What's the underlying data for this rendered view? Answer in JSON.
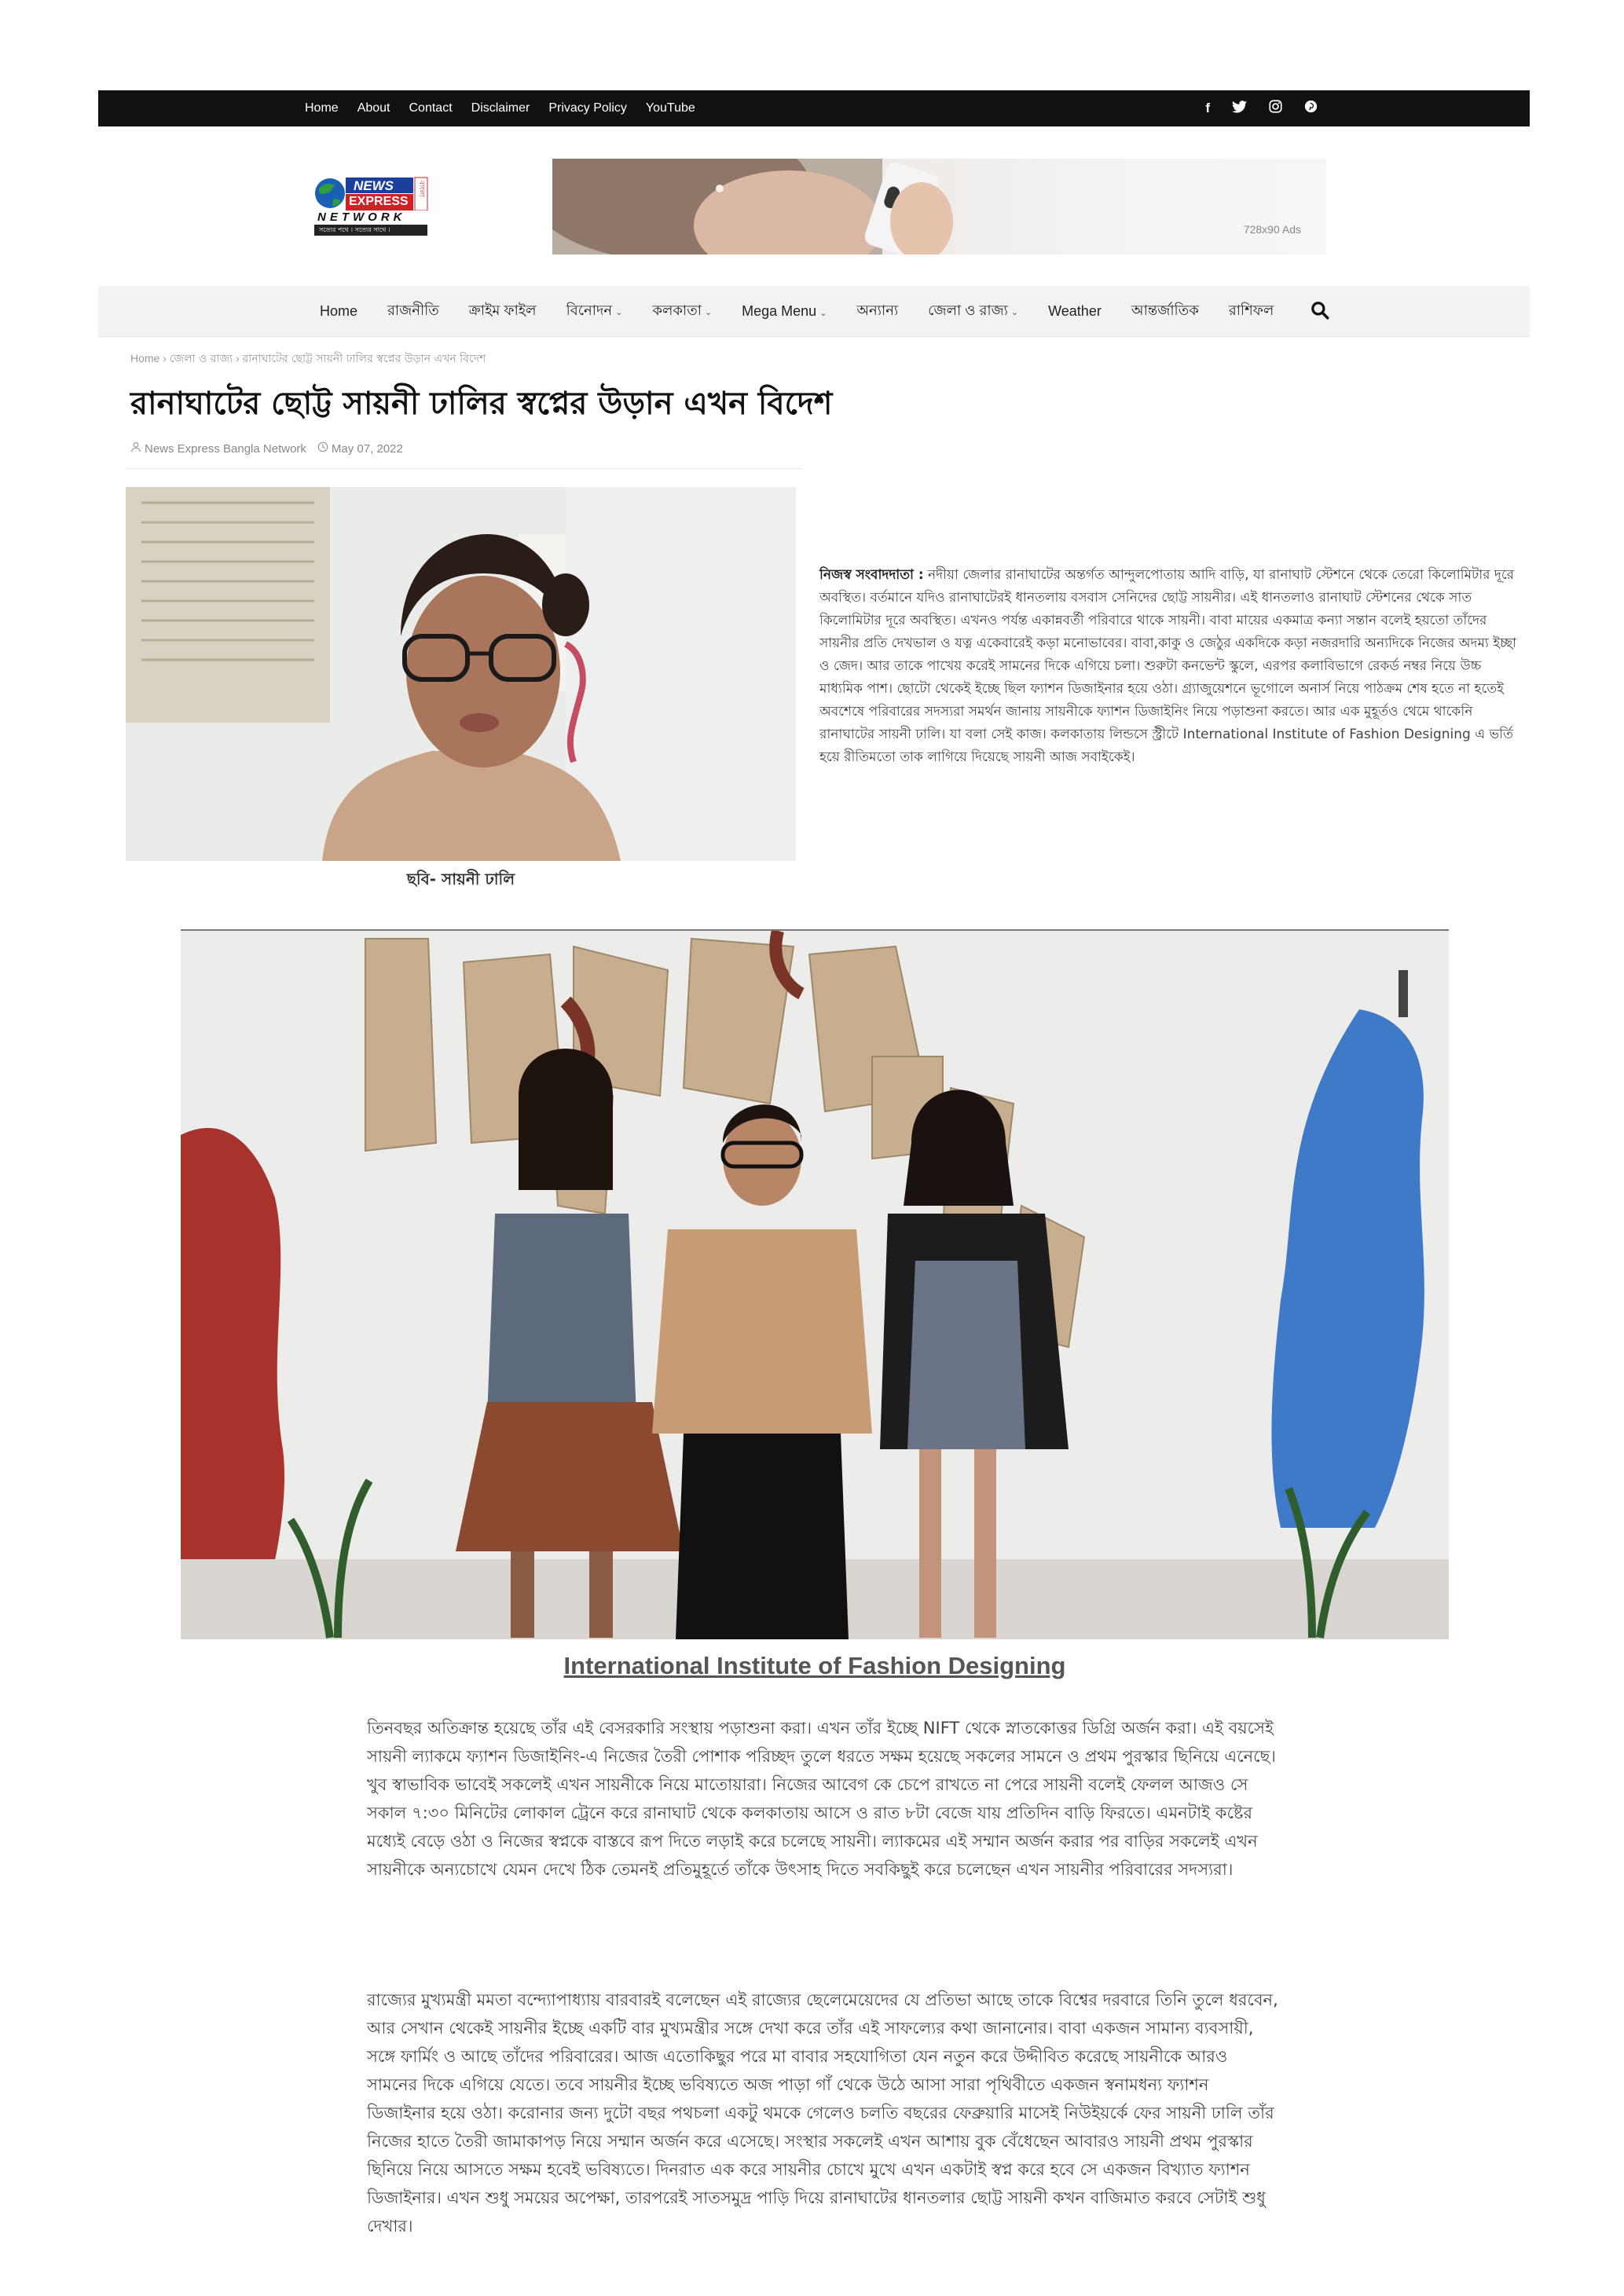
{
  "topbar": {
    "nav": [
      "Home",
      "About",
      "Contact",
      "Disclaimer",
      "Privacy Policy",
      "YouTube"
    ],
    "social": [
      "facebook-icon",
      "twitter-icon",
      "instagram-icon",
      "pinterest-icon"
    ]
  },
  "logo": {
    "line1": "NEWS",
    "line2": "EXPRESS",
    "line3": "NETWORK",
    "side": "বাংলা",
    "tagline": "সত্যের পথে । সত্যের সাথে ।"
  },
  "ad": {
    "label": "728x90 Ads"
  },
  "mainnav": {
    "items": [
      {
        "label": "Home",
        "caret": ""
      },
      {
        "label": "রাজনীতি",
        "caret": ""
      },
      {
        "label": "ক্রাইম ফাইল",
        "caret": ""
      },
      {
        "label": "বিনোদন",
        "caret": "⌄"
      },
      {
        "label": "কলকাতা",
        "caret": "⌄"
      },
      {
        "label": "Mega Menu",
        "caret": "⌄"
      },
      {
        "label": "অন্যান্য",
        "caret": ""
      },
      {
        "label": "জেলা ও রাজ্য",
        "caret": "⌄"
      },
      {
        "label": "Weather",
        "caret": ""
      },
      {
        "label": "আন্তর্জাতিক",
        "caret": ""
      },
      {
        "label": "রাশিফল",
        "caret": ""
      }
    ]
  },
  "breadcrumb": {
    "home": "Home",
    "cat": "জেলা ও রাজ্য",
    "current": "রানাঘাটের ছোট্ট সায়নী ঢালির স্বপ্নের উড়ান এখন বিদেশ",
    "sep": "›"
  },
  "article": {
    "title": "রানাঘাটের ছোট্ট সায়নী ঢালির স্বপ্নের উড়ান এখন বিদেশ",
    "author": "News Express Bangla Network",
    "date": "May 07, 2022",
    "caption1": "ছবি- সায়নী ঢালি",
    "p1_lead": "নিজস্ব সংবাদদাতা :",
    "p1": " নদীয়া জেলার রানাঘাটের অন্তর্গত আন্দুলপোতায় আদি বাড়ি, যা রানাঘাট স্টেশনে থেকে তেরো কিলোমিটার দূরে অবস্থিত। বর্তমানে যদিও রানাঘাটেরই ধানতলায় বসবাস সেনিদের ছোট্ট সায়নীর। এই ধানতলাও রানাঘাট স্টেশনের থেকে সাত কিলোমিটার দূরে অবস্থিত। এখনও পর্যন্ত একান্নবর্তী পরিবারে থাকে সায়নী। বাবা মায়ের একমাত্র কন্যা সন্তান বলেই হয়তো তাঁদের সায়নীর প্রতি দেখভাল ও যত্ন একেবারেই কড়া মনোভাবের। বাবা,কাকু ও জেঠুর একদিকে কড়া নজরদারি অন্যদিকে নিজের অদম্য ইচ্ছা ও জেদ। আর তাকে পাখেয় করেই সামনের দিকে এগিয়ে চলা। শুরুটা কনভেন্ট স্কুলে, এরপর কলাবিভাগে রেকর্ড নম্বর নিয়ে উচ্চ মাধ্যমিক পাশ। ছোটো থেকেই ইচ্ছে ছিল ফ্যাশন ডিজাইনার হয়ে ওঠা। গ্র্যাজুয়েশনে ভূগোলে অনার্স নিয়ে পাঠক্রম শেষ হতে না হতেই অবশেষে পরিবারের সদস্যরা সমর্থন জানায় সায়নীকে ফ্যাশন ডিজাইনিং নিয়ে পড়াশুনা করতে। আর এক মুহূর্তও থেমে থাকেনি রানাঘাটের সায়নী ঢালি। যা বলা সেই কাজ। কলকাতায় লিন্ডসে স্ট্রীটে International Institute of Fashion Designing এ ভর্তি হয়ে রীতিমতো তাক লাগিয়ে দিয়েছে সায়নী আজ সবাইকেই।",
    "caption2": "International Institute of Fashion Designing",
    "p2": "তিনবছর অতিক্রান্ত হয়েছে তাঁর এই বেসরকারি সংস্থায় পড়াশুনা করা। এখন তাঁর ইচ্ছে NIFT থেকে স্নাতকোত্তর ডিগ্রি অর্জন করা। এই বয়সেই সায়নী ল্যাকমে ফ্যাশন ডিজাইনিং-এ নিজের তৈরী পোশাক পরিচ্ছদ তুলে ধরতে সক্ষম হয়েছে সকলের সামনে ও প্রথম পুরস্কার ছিনিয়ে এনেছে। খুব স্বাভাবিক ভাবেই সকলেই এখন সায়নীকে নিয়ে মাতোয়ারা। নিজের আবেগ কে চেপে রাখতে না পেরে সায়নী বলেই ফেলল আজও সে সকাল ৭:৩০ মিনিটের লোকাল ট্রেনে করে রানাঘাট থেকে কলকাতায় আসে ও রাত ৮টা বেজে যায় প্রতিদিন বাড়ি ফিরতে। এমনটাই কষ্টের মধ্যেই বেড়ে ওঠা ও নিজের স্বপ্নকে বাস্তবে রূপ দিতে লড়াই করে চলেছে সায়নী। ল্যাকমের এই সম্মান অর্জন করার পর বাড়ির সকলেই এখন সায়নীকে অন্যচোখে যেমন দেখে ঠিক তেমনই প্রতিমুহূর্তে তাঁকে উৎসাহ দিতে সবকিছুই করে চলেছেন এখন সায়নীর পরিবারের সদস্যরা।",
    "p3": "রাজ্যের মুখ্যমন্ত্রী মমতা বন্দ্যোপাধ্যায় বারবারই বলেছেন এই রাজ্যের ছেলেমেয়েদের যে প্রতিভা আছে তাকে বিশ্বের দরবারে তিনি তুলে ধরবেন, আর সেখান থেকেই সায়নীর ইচ্ছে একটি বার মুখ্যমন্ত্রীর সঙ্গে দেখা করে তাঁর এই সাফল্যের কথা জানানোর। বাবা একজন সামান্য ব্যবসায়ী, সঙ্গে ফার্মিং ও আছে তাঁদের পরিবারের। আজ এতোকিছুর পরে মা বাবার সহযোগিতা যেন নতুন করে উদ্দীবিত করেছে সায়নীকে আরও সামনের দিকে এগিয়ে যেতে। তবে সায়নীর ইচ্ছে ভবিষ্যতে অজ পাড়া গাঁ থেকে উঠে আসা সারা পৃথিবীতে একজন স্বনামধন্য ফ্যাশন ডিজাইনার হয়ে ওঠা। করোনার জন্য দুটো বছর পথচলা একটু থমকে গেলেও চলতি বছরের ফেব্রুয়ারি মাসেই নিউইয়র্কে ফের সায়নী ঢালি তাঁর নিজের হাতে তৈরী জামাকাপড় নিয়ে সম্মান অর্জন করে এসেছে। সংস্থার সকলেই এখন আশায় বুক বেঁধেছেন আবারও সায়নী প্রথম পুরস্কার ছিনিয়ে নিয়ে আসতে সক্ষম হবেই ভবিষ্যতে। দিনরাত এক করে সায়নীর চোখে মুখে এখন একটাই স্বপ্ন করে হবে সে একজন বিখ্যাত ফ্যাশন ডিজাইনার। এখন শুধু সময়ের অপেক্ষা, তারপরেই সাতসমুদ্র পাড়ি দিয়ে রানাঘাটের ধানতলার ছোট্ট সায়নী কখন বাজিমাত করবে সেটাই শুধু দেখার।"
  },
  "colors": {
    "topbar": "#111111",
    "navbar": "#f2f2f2",
    "logo_red": "#d21f26",
    "logo_blue": "#1a3f9c"
  }
}
